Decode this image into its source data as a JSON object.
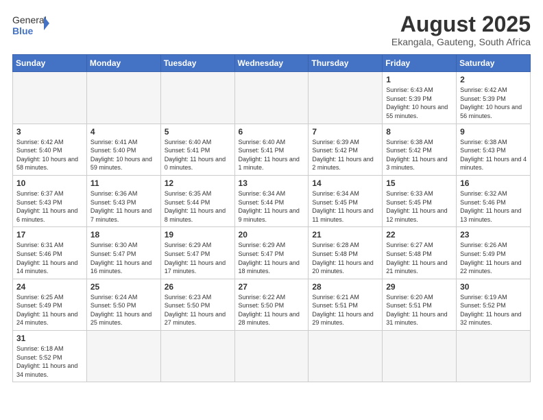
{
  "logo": {
    "text_general": "General",
    "text_blue": "Blue"
  },
  "title": "August 2025",
  "subtitle": "Ekangala, Gauteng, South Africa",
  "headers": [
    "Sunday",
    "Monday",
    "Tuesday",
    "Wednesday",
    "Thursday",
    "Friday",
    "Saturday"
  ],
  "weeks": [
    [
      {
        "day": "",
        "info": ""
      },
      {
        "day": "",
        "info": ""
      },
      {
        "day": "",
        "info": ""
      },
      {
        "day": "",
        "info": ""
      },
      {
        "day": "",
        "info": ""
      },
      {
        "day": "1",
        "info": "Sunrise: 6:43 AM\nSunset: 5:39 PM\nDaylight: 10 hours and 55 minutes."
      },
      {
        "day": "2",
        "info": "Sunrise: 6:42 AM\nSunset: 5:39 PM\nDaylight: 10 hours and 56 minutes."
      }
    ],
    [
      {
        "day": "3",
        "info": "Sunrise: 6:42 AM\nSunset: 5:40 PM\nDaylight: 10 hours and 58 minutes."
      },
      {
        "day": "4",
        "info": "Sunrise: 6:41 AM\nSunset: 5:40 PM\nDaylight: 10 hours and 59 minutes."
      },
      {
        "day": "5",
        "info": "Sunrise: 6:40 AM\nSunset: 5:41 PM\nDaylight: 11 hours and 0 minutes."
      },
      {
        "day": "6",
        "info": "Sunrise: 6:40 AM\nSunset: 5:41 PM\nDaylight: 11 hours and 1 minute."
      },
      {
        "day": "7",
        "info": "Sunrise: 6:39 AM\nSunset: 5:42 PM\nDaylight: 11 hours and 2 minutes."
      },
      {
        "day": "8",
        "info": "Sunrise: 6:38 AM\nSunset: 5:42 PM\nDaylight: 11 hours and 3 minutes."
      },
      {
        "day": "9",
        "info": "Sunrise: 6:38 AM\nSunset: 5:43 PM\nDaylight: 11 hours and 4 minutes."
      }
    ],
    [
      {
        "day": "10",
        "info": "Sunrise: 6:37 AM\nSunset: 5:43 PM\nDaylight: 11 hours and 6 minutes."
      },
      {
        "day": "11",
        "info": "Sunrise: 6:36 AM\nSunset: 5:43 PM\nDaylight: 11 hours and 7 minutes."
      },
      {
        "day": "12",
        "info": "Sunrise: 6:35 AM\nSunset: 5:44 PM\nDaylight: 11 hours and 8 minutes."
      },
      {
        "day": "13",
        "info": "Sunrise: 6:34 AM\nSunset: 5:44 PM\nDaylight: 11 hours and 9 minutes."
      },
      {
        "day": "14",
        "info": "Sunrise: 6:34 AM\nSunset: 5:45 PM\nDaylight: 11 hours and 11 minutes."
      },
      {
        "day": "15",
        "info": "Sunrise: 6:33 AM\nSunset: 5:45 PM\nDaylight: 11 hours and 12 minutes."
      },
      {
        "day": "16",
        "info": "Sunrise: 6:32 AM\nSunset: 5:46 PM\nDaylight: 11 hours and 13 minutes."
      }
    ],
    [
      {
        "day": "17",
        "info": "Sunrise: 6:31 AM\nSunset: 5:46 PM\nDaylight: 11 hours and 14 minutes."
      },
      {
        "day": "18",
        "info": "Sunrise: 6:30 AM\nSunset: 5:47 PM\nDaylight: 11 hours and 16 minutes."
      },
      {
        "day": "19",
        "info": "Sunrise: 6:29 AM\nSunset: 5:47 PM\nDaylight: 11 hours and 17 minutes."
      },
      {
        "day": "20",
        "info": "Sunrise: 6:29 AM\nSunset: 5:47 PM\nDaylight: 11 hours and 18 minutes."
      },
      {
        "day": "21",
        "info": "Sunrise: 6:28 AM\nSunset: 5:48 PM\nDaylight: 11 hours and 20 minutes."
      },
      {
        "day": "22",
        "info": "Sunrise: 6:27 AM\nSunset: 5:48 PM\nDaylight: 11 hours and 21 minutes."
      },
      {
        "day": "23",
        "info": "Sunrise: 6:26 AM\nSunset: 5:49 PM\nDaylight: 11 hours and 22 minutes."
      }
    ],
    [
      {
        "day": "24",
        "info": "Sunrise: 6:25 AM\nSunset: 5:49 PM\nDaylight: 11 hours and 24 minutes."
      },
      {
        "day": "25",
        "info": "Sunrise: 6:24 AM\nSunset: 5:50 PM\nDaylight: 11 hours and 25 minutes."
      },
      {
        "day": "26",
        "info": "Sunrise: 6:23 AM\nSunset: 5:50 PM\nDaylight: 11 hours and 27 minutes."
      },
      {
        "day": "27",
        "info": "Sunrise: 6:22 AM\nSunset: 5:50 PM\nDaylight: 11 hours and 28 minutes."
      },
      {
        "day": "28",
        "info": "Sunrise: 6:21 AM\nSunset: 5:51 PM\nDaylight: 11 hours and 29 minutes."
      },
      {
        "day": "29",
        "info": "Sunrise: 6:20 AM\nSunset: 5:51 PM\nDaylight: 11 hours and 31 minutes."
      },
      {
        "day": "30",
        "info": "Sunrise: 6:19 AM\nSunset: 5:52 PM\nDaylight: 11 hours and 32 minutes."
      }
    ],
    [
      {
        "day": "31",
        "info": "Sunrise: 6:18 AM\nSunset: 5:52 PM\nDaylight: 11 hours and 34 minutes."
      },
      {
        "day": "",
        "info": ""
      },
      {
        "day": "",
        "info": ""
      },
      {
        "day": "",
        "info": ""
      },
      {
        "day": "",
        "info": ""
      },
      {
        "day": "",
        "info": ""
      },
      {
        "day": "",
        "info": ""
      }
    ]
  ]
}
